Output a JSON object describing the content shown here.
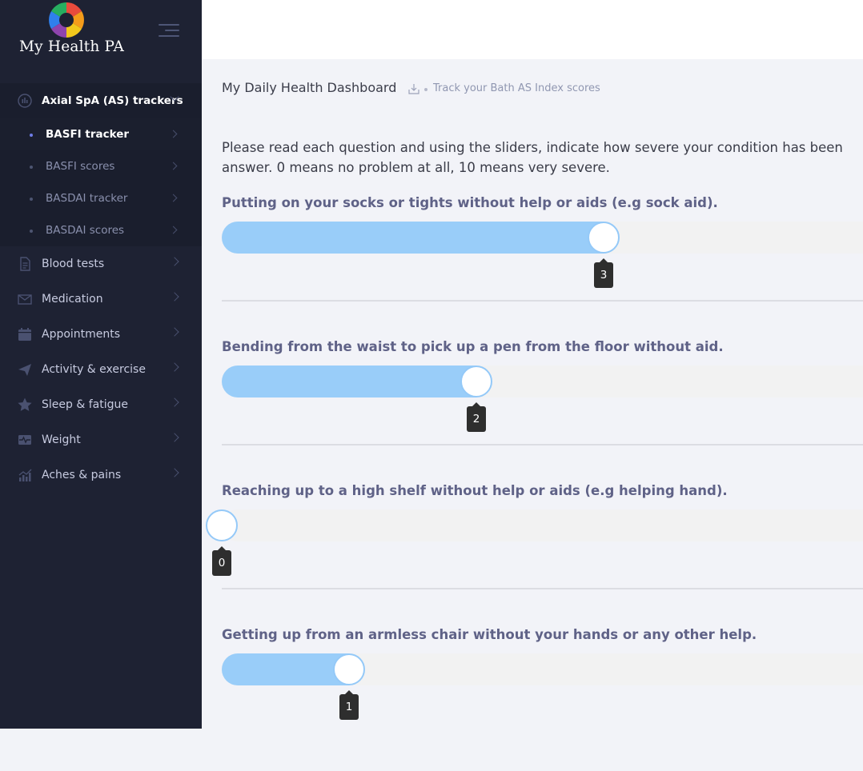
{
  "brand": {
    "name": "My Health PA"
  },
  "sidebar": {
    "group": {
      "label": "Axial SpA (AS) trackers",
      "icon": "chart-icon"
    },
    "sub_items": [
      {
        "label": "BASFI tracker",
        "active": true
      },
      {
        "label": "BASFI scores",
        "active": false
      },
      {
        "label": "BASDAI tracker",
        "active": false
      },
      {
        "label": "BASDAI scores",
        "active": false
      }
    ],
    "items": [
      {
        "label": "Blood tests",
        "icon": "document-icon"
      },
      {
        "label": "Medication",
        "icon": "mail-icon"
      },
      {
        "label": "Appointments",
        "icon": "calendar-icon"
      },
      {
        "label": "Activity & exercise",
        "icon": "send-icon"
      },
      {
        "label": "Sleep & fatigue",
        "icon": "star-icon"
      },
      {
        "label": "Weight",
        "icon": "pulse-icon"
      },
      {
        "label": "Aches & pains",
        "icon": "graph-icon"
      }
    ]
  },
  "header": {
    "title": "My Daily Health Dashboard",
    "breadcrumb": "Track your Bath AS Index scores"
  },
  "intro": {
    "line1": "Please read each question and using the sliders, indicate how severe your condition has been",
    "line2": "answer. 0 means no problem at all, 10 means very severe."
  },
  "slider_scale": {
    "min": 0,
    "max": 10
  },
  "questions": [
    {
      "text": "Putting on your socks or tights without help or aids (e.g sock aid).",
      "value": 3,
      "value_label": "3"
    },
    {
      "text": "Bending from the waist to pick up a pen from the floor without aid.",
      "value": 2,
      "value_label": "2"
    },
    {
      "text": "Reaching up to a high shelf without help or aids (e.g helping hand).",
      "value": 0,
      "value_label": "0"
    },
    {
      "text": "Getting up from an armless chair without your hands or any other help.",
      "value": 1,
      "value_label": "1"
    }
  ],
  "colors": {
    "sidebar_bg": "#1e2233",
    "slider_fill": "#99cdf9",
    "question_text": "#5f6287",
    "tooltip_bg": "#2e2e2e"
  }
}
